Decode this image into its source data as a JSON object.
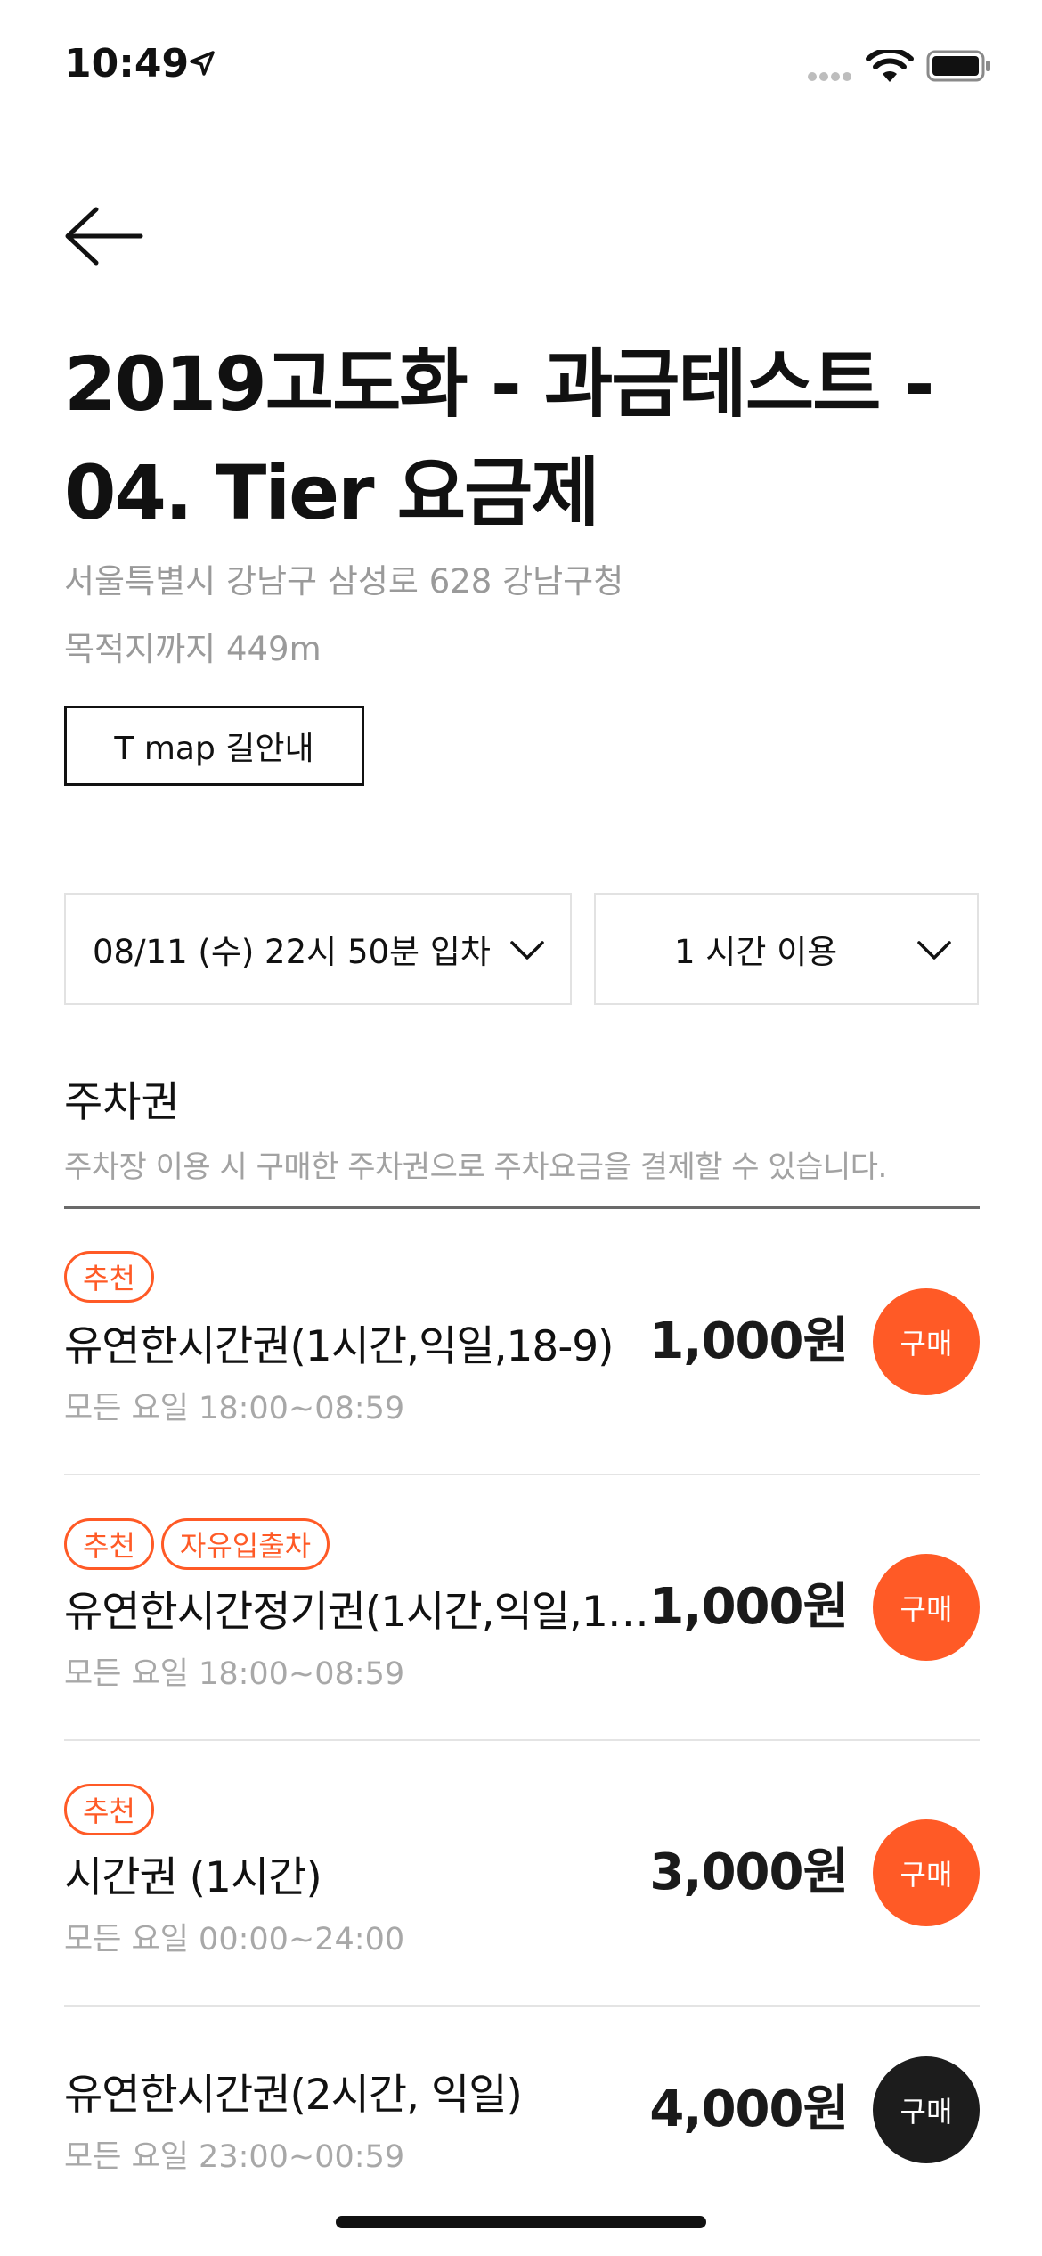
{
  "status_bar": {
    "time": "10:49",
    "icons": [
      "location-arrow-icon",
      "signal-dots-icon",
      "wifi-icon",
      "battery-icon"
    ]
  },
  "header": {
    "back_icon": "arrow-left-icon",
    "title": "2019고도화 - 과금테스트 - 04. Tier 요금제",
    "address": "서울특별시 강남구 삼성로 628 강남구청",
    "distance": "목적지까지 449m",
    "tmap_button": "T map 길안내"
  },
  "selectors": {
    "entry": "08/11 (수) 22시 50분 입차",
    "duration": "1 시간 이용",
    "chevron_icon": "chevron-down-icon"
  },
  "section": {
    "title": "주차권",
    "description": "주차장 이용 시 구매한 주차권으로 주차요금을 결제할 수 있습니다."
  },
  "tickets": [
    {
      "badges": [
        "추천"
      ],
      "name": "유연한시간권(1시간,익일,18-9)",
      "schedule": "모든 요일  18:00~08:59",
      "price": "1,000원",
      "buy_label": "구매",
      "buy_color": "#ff5a26"
    },
    {
      "badges": [
        "추천",
        "자유입출차"
      ],
      "name": "유연한시간정기권(1시간,익일,1…",
      "schedule": "모든 요일  18:00~08:59",
      "price": "1,000원",
      "buy_label": "구매",
      "buy_color": "#ff5a26"
    },
    {
      "badges": [
        "추천"
      ],
      "name": "시간권 (1시간)",
      "schedule": "모든 요일  00:00~24:00",
      "price": "3,000원",
      "buy_label": "구매",
      "buy_color": "#ff5a26"
    },
    {
      "badges": [],
      "name": "유연한시간권(2시간, 익일)",
      "schedule": "모든 요일  23:00~00:59",
      "price": "4,000원",
      "buy_label": "구매",
      "buy_color": "#1c1c1c"
    }
  ],
  "colors": {
    "accent": "#ff5a26",
    "text": "#111111",
    "muted": "#9a9a9a",
    "dark_button": "#1c1c1c"
  }
}
